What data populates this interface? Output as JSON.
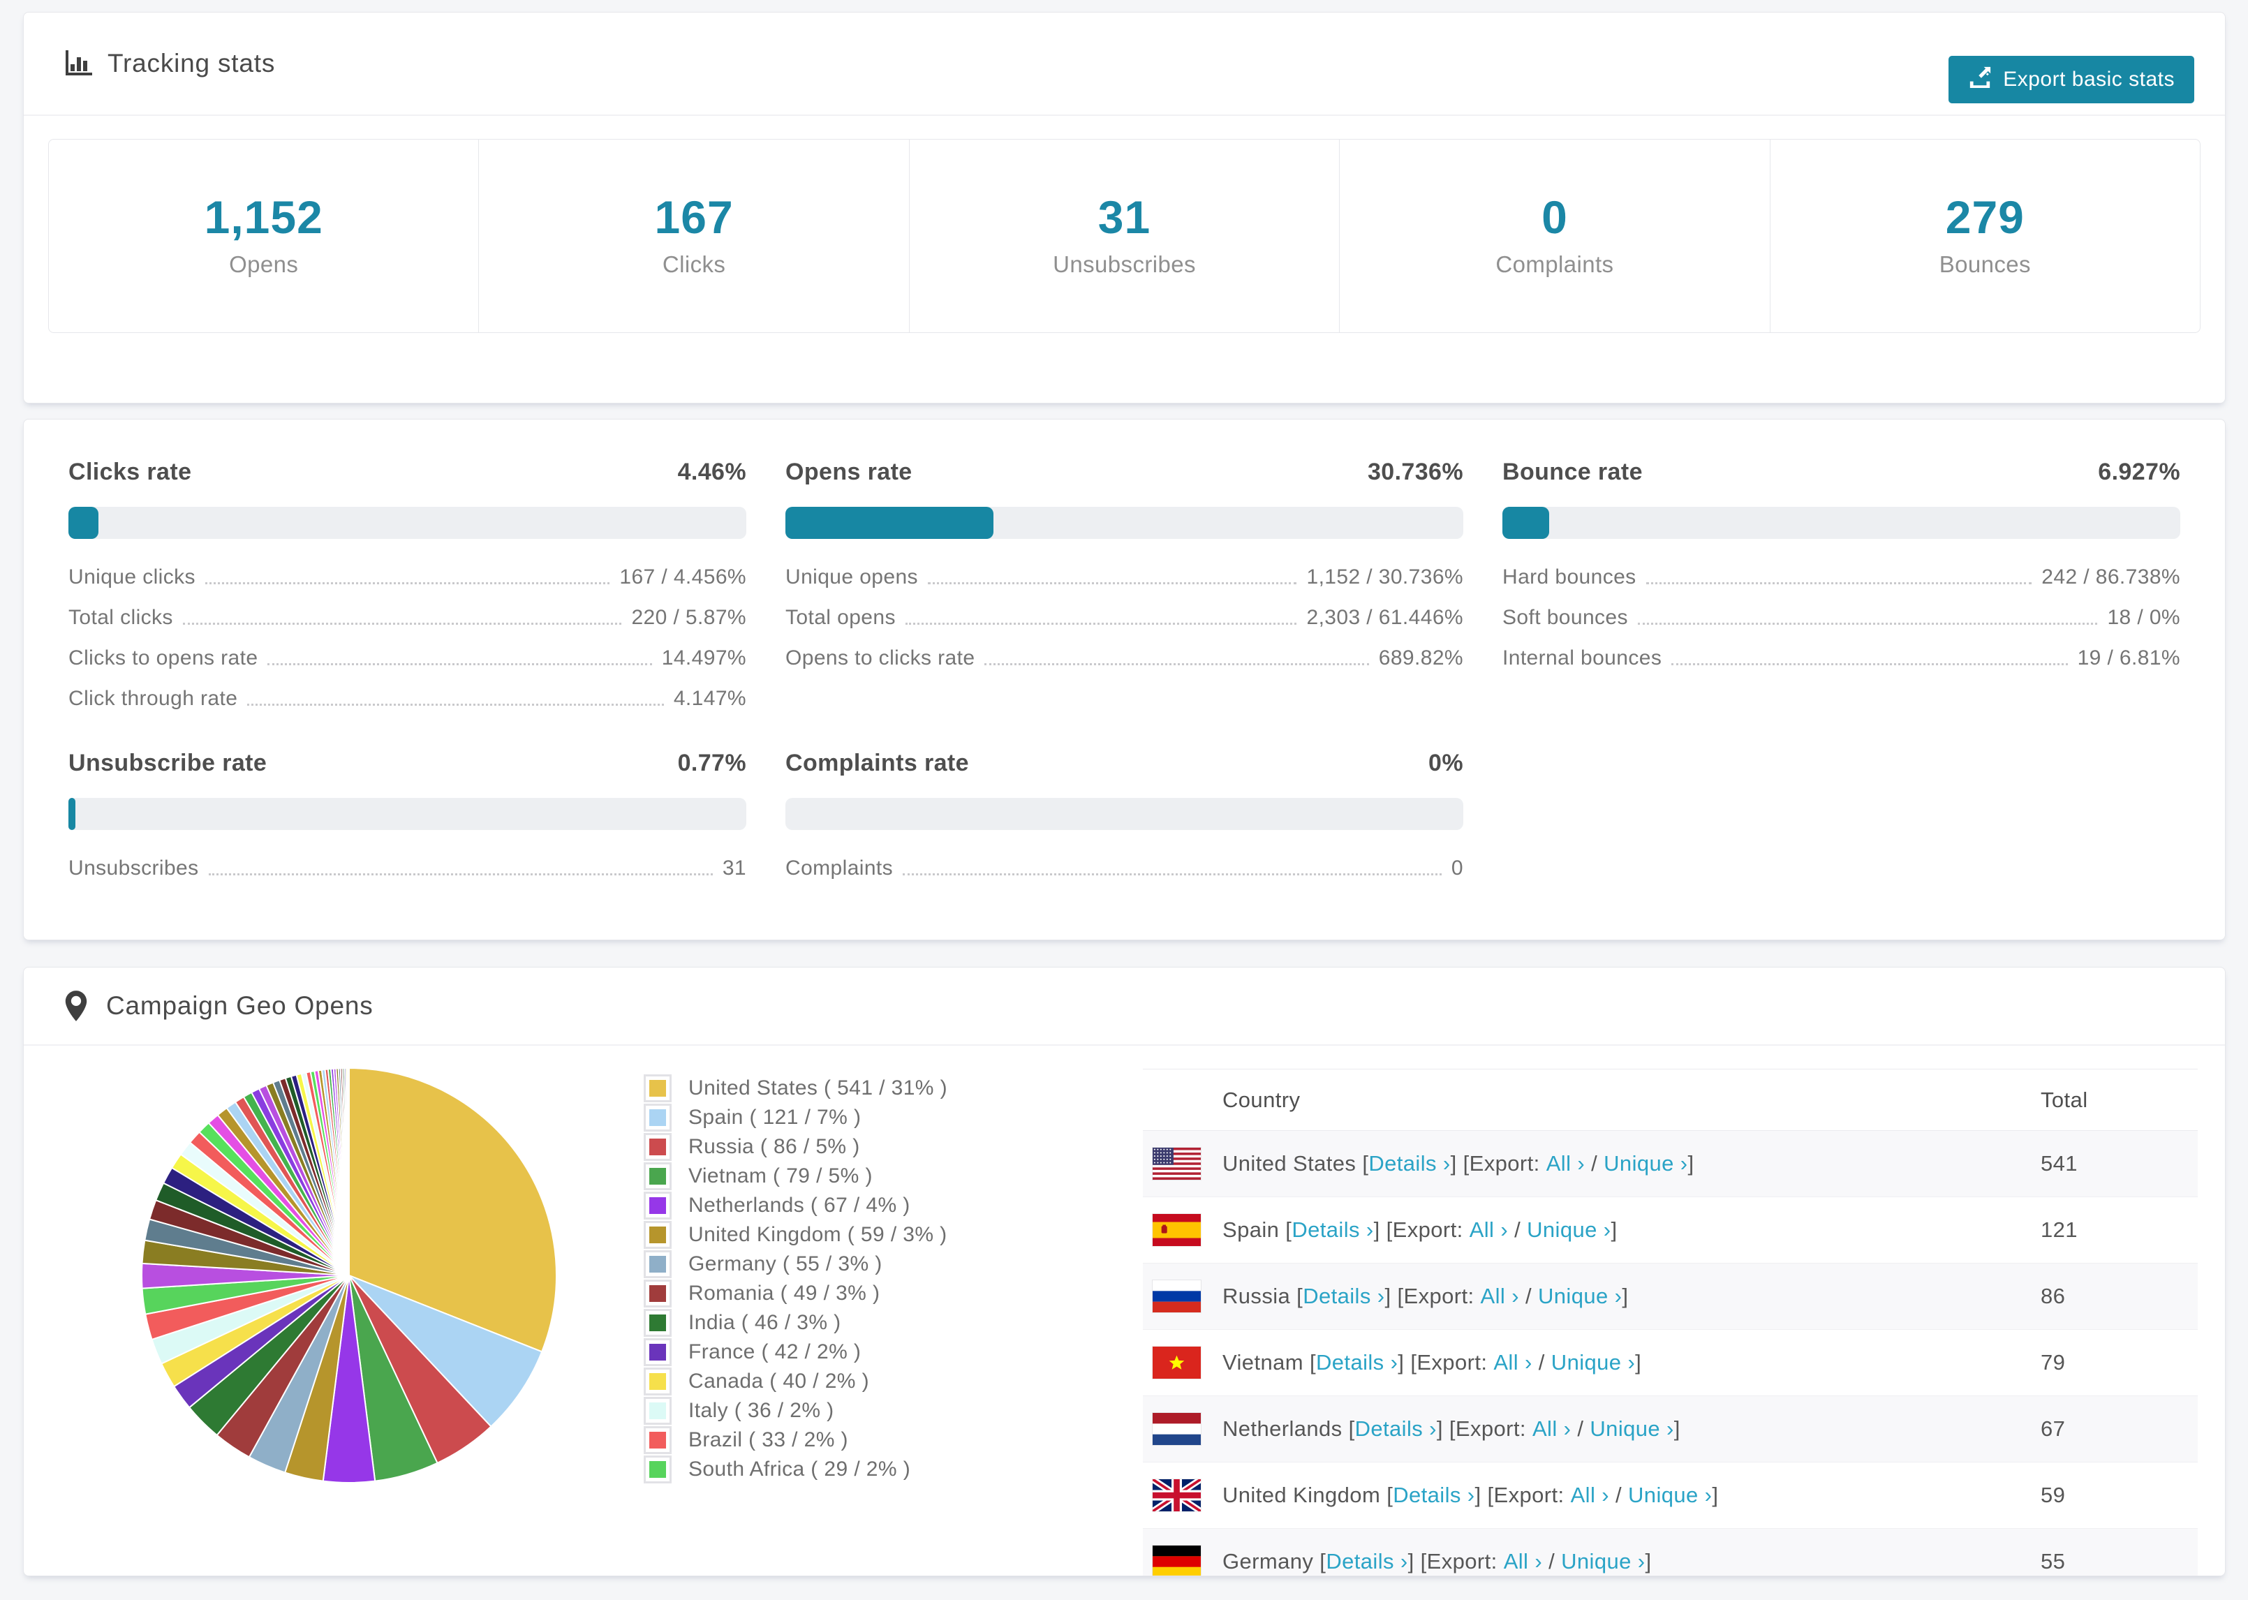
{
  "tracking": {
    "title": "Tracking stats",
    "export_button": "Export basic stats",
    "summary": [
      {
        "value": "1,152",
        "label": "Opens"
      },
      {
        "value": "167",
        "label": "Clicks"
      },
      {
        "value": "31",
        "label": "Unsubscribes"
      },
      {
        "value": "0",
        "label": "Complaints"
      },
      {
        "value": "279",
        "label": "Bounces"
      }
    ]
  },
  "rates": [
    {
      "title": "Clicks rate",
      "value": "4.46%",
      "percent": 4.46,
      "rows": [
        {
          "label": "Unique clicks",
          "value": "167 / 4.456%"
        },
        {
          "label": "Total clicks",
          "value": "220 / 5.87%"
        },
        {
          "label": "Clicks to opens rate",
          "value": "14.497%"
        },
        {
          "label": "Click through rate",
          "value": "4.147%"
        }
      ]
    },
    {
      "title": "Opens rate",
      "value": "30.736%",
      "percent": 30.736,
      "rows": [
        {
          "label": "Unique opens",
          "value": "1,152 / 30.736%"
        },
        {
          "label": "Total opens",
          "value": "2,303 / 61.446%"
        },
        {
          "label": "Opens to clicks rate",
          "value": "689.82%"
        }
      ]
    },
    {
      "title": "Bounce rate",
      "value": "6.927%",
      "percent": 6.927,
      "rows": [
        {
          "label": "Hard bounces",
          "value": "242 / 86.738%"
        },
        {
          "label": "Soft bounces",
          "value": "18 / 0%"
        },
        {
          "label": "Internal bounces",
          "value": "19 / 6.81%"
        }
      ]
    },
    {
      "title": "Unsubscribe rate",
      "value": "0.77%",
      "percent": 0.77,
      "rows": [
        {
          "label": "Unsubscribes",
          "value": "31"
        }
      ]
    },
    {
      "title": "Complaints rate",
      "value": "0%",
      "percent": 0,
      "rows": [
        {
          "label": "Complaints",
          "value": "0"
        }
      ]
    }
  ],
  "geo": {
    "title": "Campaign Geo Opens",
    "chart_data": {
      "type": "pie",
      "title": "Campaign Geo Opens",
      "legend_position": "right",
      "series": [
        {
          "name": "United States",
          "value": 541,
          "pct": 31,
          "color": "#e7c24a"
        },
        {
          "name": "Spain",
          "value": 121,
          "pct": 7,
          "color": "#abd4f3"
        },
        {
          "name": "Russia",
          "value": 86,
          "pct": 5,
          "color": "#cc4b4e"
        },
        {
          "name": "Vietnam",
          "value": 79,
          "pct": 5,
          "color": "#4aa64e"
        },
        {
          "name": "Netherlands",
          "value": 67,
          "pct": 4,
          "color": "#9637e8"
        },
        {
          "name": "United Kingdom",
          "value": 59,
          "pct": 3,
          "color": "#b6952c"
        },
        {
          "name": "Germany",
          "value": 55,
          "pct": 3,
          "color": "#8fafc8"
        },
        {
          "name": "Romania",
          "value": 49,
          "pct": 3,
          "color": "#a03c3c"
        },
        {
          "name": "India",
          "value": 46,
          "pct": 3,
          "color": "#2e7a33"
        },
        {
          "name": "France",
          "value": 42,
          "pct": 2,
          "color": "#6a34bb"
        },
        {
          "name": "Canada",
          "value": 40,
          "pct": 2,
          "color": "#f6e04b"
        },
        {
          "name": "Italy",
          "value": 36,
          "pct": 2,
          "color": "#dcfaf6"
        },
        {
          "name": "Brazil",
          "value": 33,
          "pct": 2,
          "color": "#f25c5c"
        },
        {
          "name": "South Africa",
          "value": 29,
          "pct": 2,
          "color": "#57d45c"
        }
      ],
      "other_slices_weights": [
        1.9,
        1.77,
        1.64,
        1.53,
        1.42,
        1.32,
        1.23,
        1.14,
        1.06,
        0.99,
        0.92,
        0.86,
        0.8,
        0.74,
        0.69,
        0.64,
        0.6,
        0.56,
        0.52,
        0.48,
        0.45,
        0.42,
        0.39,
        0.36,
        0.34,
        0.31,
        0.29,
        0.27,
        0.25,
        0.23,
        0.22,
        0.2,
        0.19,
        0.18,
        0.16,
        0.15,
        0.14,
        0.13,
        0.12,
        0.11
      ],
      "other_slices_palette": [
        "#b84fe0",
        "#8a7d22",
        "#5f7d8e",
        "#7c2b2b",
        "#1f5c28",
        "#2c2080",
        "#f6f649",
        "#e9fcfc",
        "#f25c5c",
        "#57e05c",
        "#e44fe4",
        "#b6952c",
        "#abd4f3",
        "#e05555",
        "#44b34d",
        "#8a3de0"
      ]
    },
    "table": {
      "columns": [
        "Country",
        "Total"
      ],
      "labels": {
        "details": "Details ›",
        "export": "Export:",
        "all": "All ›",
        "unique": "Unique ›"
      },
      "rows": [
        {
          "flag": "us",
          "country": "United States",
          "total": "541"
        },
        {
          "flag": "es",
          "country": "Spain",
          "total": "121"
        },
        {
          "flag": "ru",
          "country": "Russia",
          "total": "86"
        },
        {
          "flag": "vn",
          "country": "Vietnam",
          "total": "79"
        },
        {
          "flag": "nl",
          "country": "Netherlands",
          "total": "67"
        },
        {
          "flag": "gb",
          "country": "United Kingdom",
          "total": "59"
        },
        {
          "flag": "de",
          "country": "Germany",
          "total": "55"
        }
      ]
    }
  },
  "colors": {
    "accent": "#1787a3",
    "link": "#2aa3c6",
    "number": "#1b87a6",
    "bar_track": "#edeff2"
  }
}
